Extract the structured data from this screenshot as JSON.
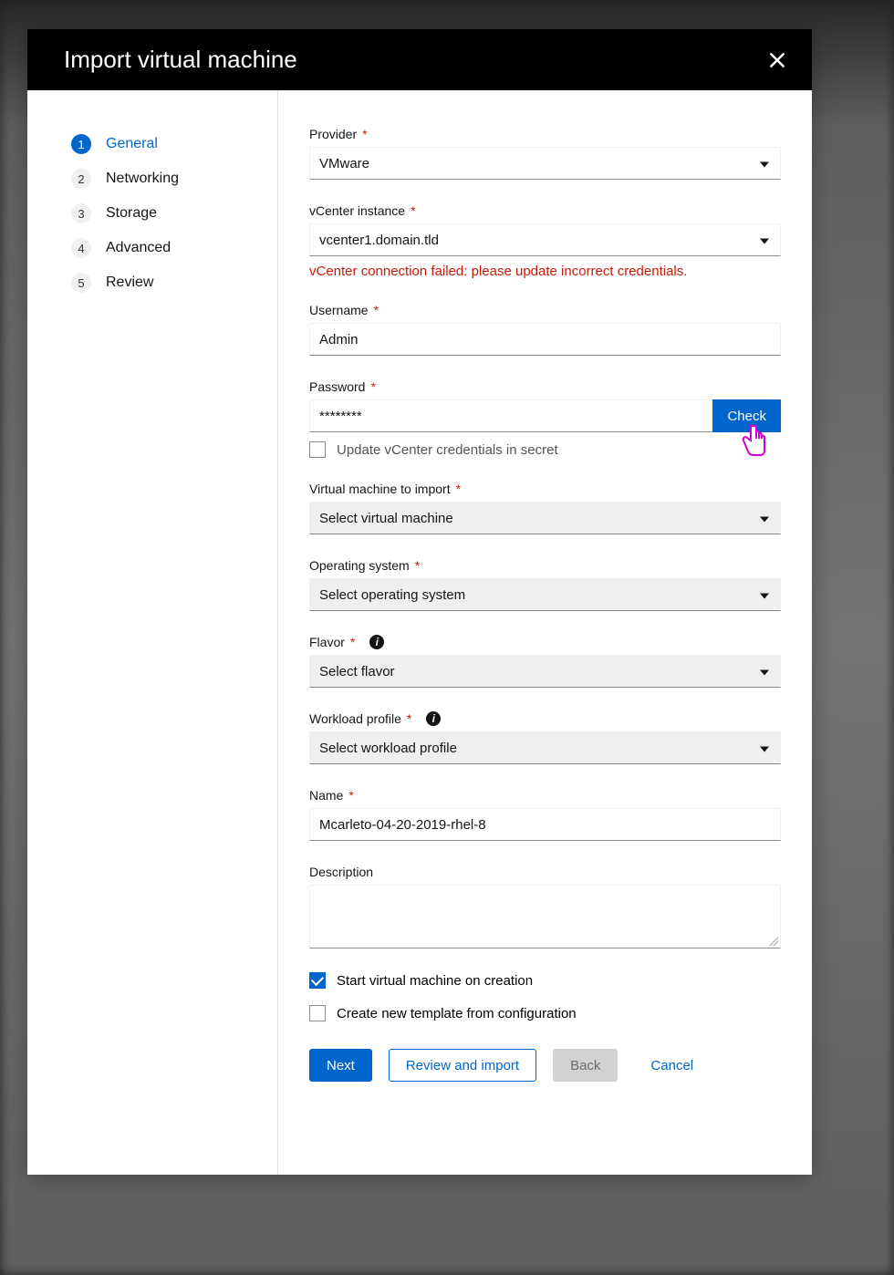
{
  "modal": {
    "title": "Import virtual machine"
  },
  "steps": [
    {
      "num": "1",
      "label": "General",
      "active": true
    },
    {
      "num": "2",
      "label": "Networking",
      "active": false
    },
    {
      "num": "3",
      "label": "Storage",
      "active": false
    },
    {
      "num": "4",
      "label": "Advanced",
      "active": false
    },
    {
      "num": "5",
      "label": "Review",
      "active": false
    }
  ],
  "form": {
    "provider": {
      "label": "Provider",
      "value": "VMware"
    },
    "vcenter": {
      "label": "vCenter instance",
      "value": "vcenter1.domain.tld",
      "error": "vCenter connection failed: please update incorrect credentials."
    },
    "username": {
      "label": "Username",
      "value": "Admin"
    },
    "password": {
      "label": "Password",
      "value": "********",
      "check_label": "Check",
      "update_secret_label": "Update vCenter credentials in secret"
    },
    "vm_import": {
      "label": "Virtual machine to import",
      "value": "Select virtual machine"
    },
    "os": {
      "label": "Operating system",
      "value": "Select operating system"
    },
    "flavor": {
      "label": "Flavor",
      "value": "Select flavor"
    },
    "workload": {
      "label": "Workload profile",
      "value": "Select workload profile"
    },
    "name": {
      "label": "Name",
      "value": "Mcarleto-04-20-2019-rhel-8"
    },
    "description": {
      "label": "Description",
      "value": ""
    },
    "start_on_create": {
      "label": "Start virtual machine on creation",
      "checked": true
    },
    "create_template": {
      "label": "Create new template from configuration",
      "checked": false
    }
  },
  "footer": {
    "next": "Next",
    "review": "Review and import",
    "back": "Back",
    "cancel": "Cancel"
  }
}
